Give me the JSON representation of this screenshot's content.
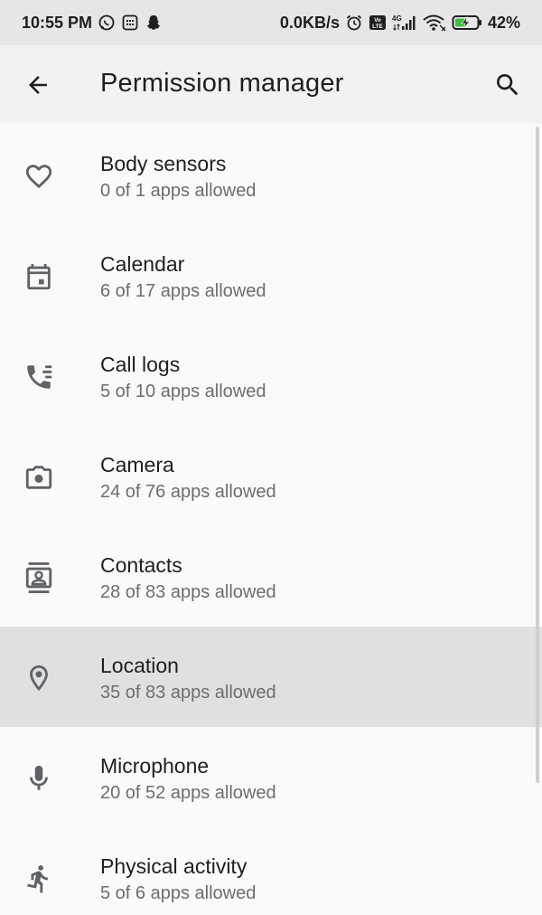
{
  "status_bar": {
    "time": "10:55 PM",
    "network_speed": "0.0KB/s",
    "volte_label": "Vo\nLTE",
    "network_type": "4G",
    "battery_percent": "42%",
    "icons": [
      "whatsapp-icon",
      "app-notification-icon",
      "snapchat-icon",
      "alarm-icon",
      "volte-icon",
      "signal-icon",
      "wifi-icon",
      "battery-charging-icon"
    ]
  },
  "app_bar": {
    "title": "Permission manager",
    "back_icon": "arrow-back-icon",
    "search_icon": "search-icon"
  },
  "permissions": [
    {
      "label": "Body sensors",
      "summary": "0 of 1 apps allowed",
      "icon": "heart-icon",
      "selected": false
    },
    {
      "label": "Calendar",
      "summary": "6 of 17 apps allowed",
      "icon": "calendar-icon",
      "selected": false
    },
    {
      "label": "Call logs",
      "summary": "5 of 10 apps allowed",
      "icon": "call-log-icon",
      "selected": false
    },
    {
      "label": "Camera",
      "summary": "24 of 76 apps allowed",
      "icon": "camera-icon",
      "selected": false
    },
    {
      "label": "Contacts",
      "summary": "28 of 83 apps allowed",
      "icon": "contacts-icon",
      "selected": false
    },
    {
      "label": "Location",
      "summary": "35 of 83 apps allowed",
      "icon": "location-pin-icon",
      "selected": true
    },
    {
      "label": "Microphone",
      "summary": "20 of 52 apps allowed",
      "icon": "microphone-icon",
      "selected": false
    },
    {
      "label": "Physical activity",
      "summary": "5 of 6 apps allowed",
      "icon": "running-icon",
      "selected": false
    }
  ],
  "colors": {
    "status_bar_bg": "#e6e6e6",
    "app_bar_bg": "#f2f2f2",
    "list_bg": "#fafafa",
    "selected_bg": "#e0e0e0",
    "title_text": "#1f1f1f",
    "subtitle_text": "#6d6d6d",
    "icon": "#5f6368",
    "battery_green": "#3dbf3d"
  }
}
